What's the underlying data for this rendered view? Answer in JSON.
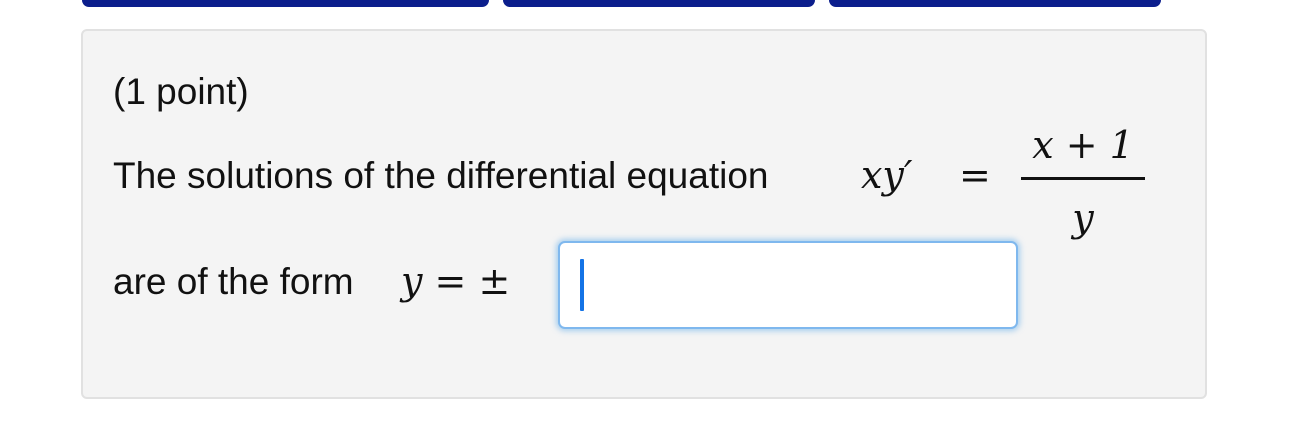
{
  "problem": {
    "points_label": "(1 point)",
    "statement_text": "The solutions of the differential equation",
    "equation": {
      "lhs": "xy′",
      "equals": "=",
      "numerator": "x + 1",
      "denominator": "y"
    },
    "answer_prefix_text": "are of the form",
    "answer_prefix_math": "y = ±",
    "answer_input": {
      "value": "",
      "placeholder": ""
    }
  },
  "colors": {
    "top_tabs": "#0b1e8c",
    "panel_background": "#f4f4f4",
    "input_focus_border": "#7fb8ee",
    "caret": "#1473e6"
  }
}
